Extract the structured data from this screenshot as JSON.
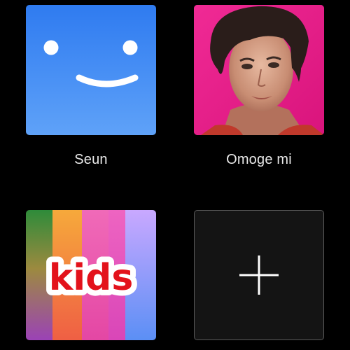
{
  "profiles": [
    {
      "name": "Seun",
      "avatar": "smiley-avatar"
    },
    {
      "name": "Omoge mi",
      "avatar": "portrait-photo-avatar"
    },
    {
      "name": "",
      "avatar": "kids-avatar",
      "logo_text": "kids"
    },
    {
      "name": "",
      "avatar": "add-profile-plus-icon"
    }
  ],
  "colors": {
    "background": "#000000",
    "smiley_blue": "#3d86f3",
    "photo_pink": "#ec1f8c",
    "kids_stripes": [
      "#e04f42",
      "#f2b333",
      "#e94fa8",
      "#f06bbd",
      "#b8a8f2"
    ],
    "kids_logo_red": "#e3121b",
    "add_tile_bg": "#141414",
    "label_text": "#e8e8e8"
  }
}
